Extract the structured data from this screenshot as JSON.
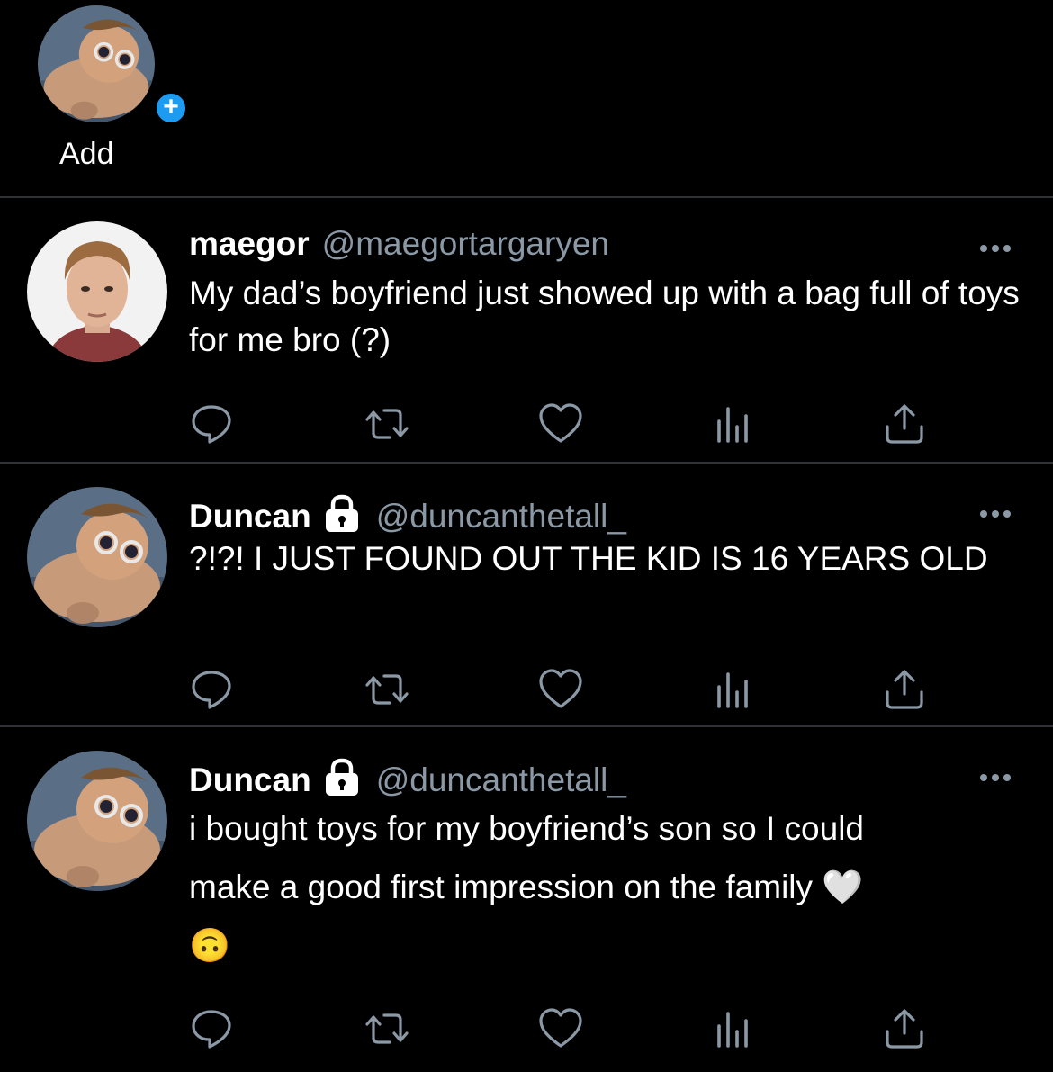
{
  "fleets": {
    "add_label": "Add",
    "plus_symbol": "+"
  },
  "tweets": [
    {
      "display_name": "maegor",
      "handle": "@maegortargaryen",
      "protected": false,
      "text": "My dad’s boyfriend just showed up with a bag full of toys for me bro (?)",
      "avatar": "avatar-maegor"
    },
    {
      "display_name": "Duncan",
      "handle": "@duncanthetall_",
      "protected": true,
      "text": "?!?! I JUST FOUND OUT THE KID IS 16 YEARS OLD",
      "avatar": "avatar-duncan"
    },
    {
      "display_name": "Duncan",
      "handle": "@duncanthetall_",
      "protected": true,
      "text_line1": "i bought toys for my boyfriend’s son so I could",
      "text_line2": "make a good first impression on the family",
      "text_emoji1": "🤍",
      "text_emoji2": "🙃",
      "avatar": "avatar-duncan"
    }
  ],
  "action_icons": [
    "reply-icon",
    "retweet-icon",
    "like-icon",
    "analytics-icon",
    "share-icon"
  ],
  "colors": {
    "background": "#000000",
    "text": "#ffffff",
    "secondary": "#8b98a5",
    "accent": "#1d9bf0",
    "divider": "#2f3336"
  }
}
